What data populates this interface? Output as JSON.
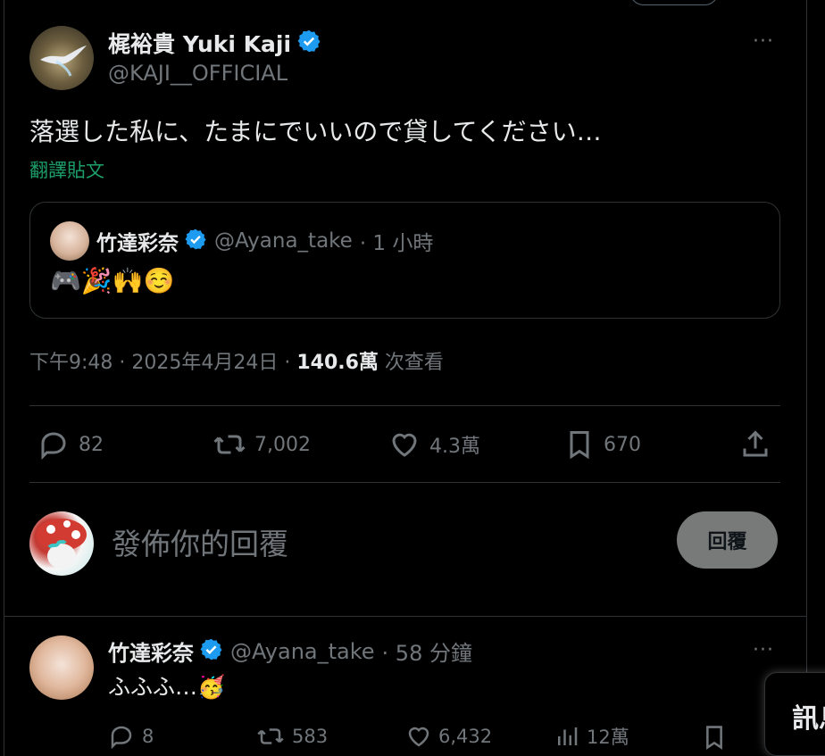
{
  "main_tweet": {
    "display_name": "梶裕貴 Yuki Kaji",
    "handle": "@KAJI__OFFICIAL",
    "more": "···",
    "text": "落選した私に、たまにでいいので貸してください…",
    "translate": "翻譯貼文",
    "quote": {
      "display_name": "竹達彩奈",
      "handle": "@Ayana_take",
      "time": "· 1 小時",
      "text": "🎮🎉🙌☺️"
    },
    "timestamp": {
      "time": "下午9:48 · 2025年4月24日 · ",
      "views_count": "140.6萬",
      "views_label": " 次查看"
    },
    "actions": {
      "replies": "82",
      "reposts": "7,002",
      "likes": "4.3萬",
      "bookmarks": "670"
    }
  },
  "reply_composer": {
    "placeholder": "發佈你的回覆",
    "button": "回覆"
  },
  "reply_tweet": {
    "display_name": "竹達彩奈",
    "handle": "@Ayana_take",
    "time": "· 58 分鐘",
    "more": "···",
    "text": "ふふふ…🥳",
    "actions": {
      "replies": "8",
      "reposts": "583",
      "likes": "6,432",
      "views": "12萬"
    }
  },
  "toast": {
    "label": "訊息"
  },
  "colors": {
    "verified": "#1d9bf0",
    "translate": "#1d9f6a",
    "muted": "#71767b",
    "border": "#2f3336"
  }
}
